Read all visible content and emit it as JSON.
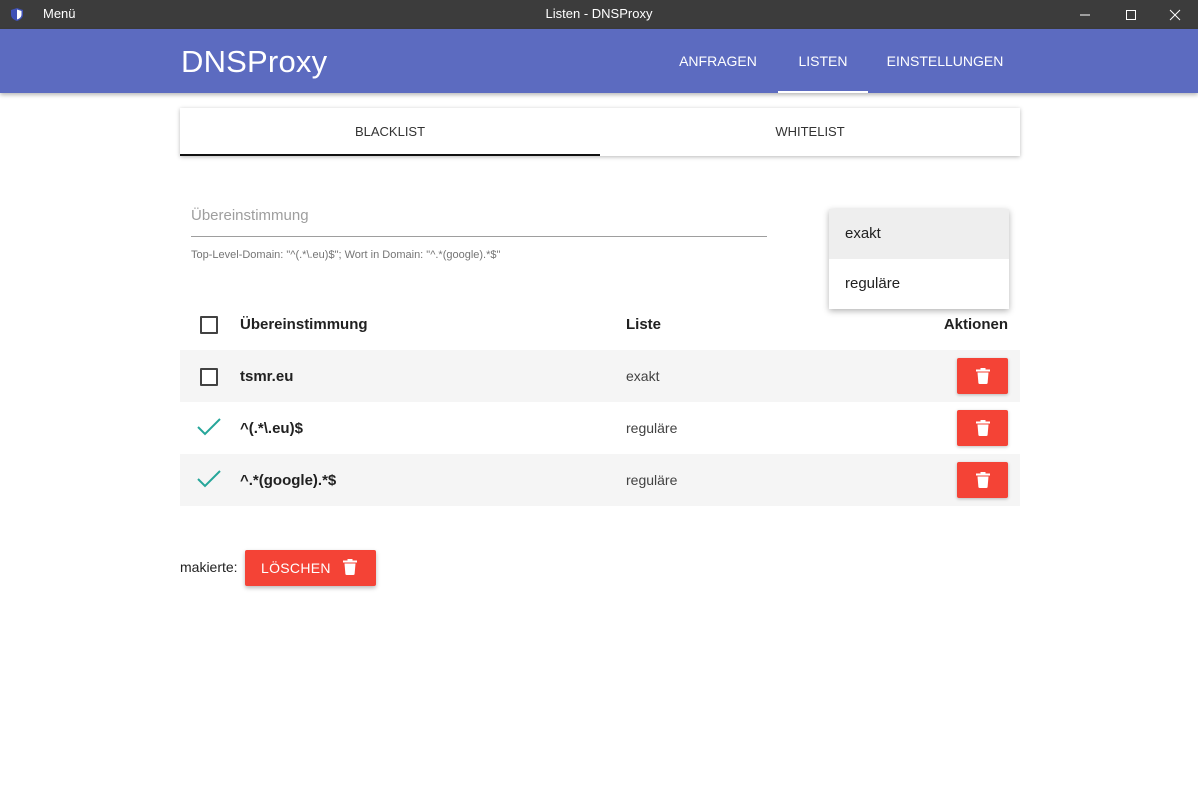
{
  "window": {
    "menu_label": "Menü",
    "title": "Listen - DNSProxy"
  },
  "appbar": {
    "brand": "DNSProxy",
    "nav": [
      "ANFRAGEN",
      "LISTEN",
      "EINSTELLUNGEN"
    ],
    "active_nav": "LISTEN"
  },
  "subtabs": {
    "items": [
      "BLACKLIST",
      "WHITELIST"
    ],
    "active": "BLACKLIST"
  },
  "form": {
    "placeholder": "Übereinstimmung",
    "value": "",
    "hint": "Top-Level-Domain: \"^(.*\\.eu)$\"; Wort in Domain: \"^.*(google).*$\"",
    "dropdown_options": [
      "exakt",
      "reguläre"
    ],
    "dropdown_highlighted": "exakt"
  },
  "table": {
    "headers": {
      "match": "Übereinstimmung",
      "list": "Liste",
      "actions": "Aktionen"
    },
    "rows": [
      {
        "match": "tsmr.eu",
        "list": "exakt",
        "checked": false
      },
      {
        "match": "^(.*\\.eu)$",
        "list": "reguläre",
        "checked": true
      },
      {
        "match": "^.*(google).*$",
        "list": "reguläre",
        "checked": true
      }
    ]
  },
  "bulk": {
    "label": "makierte:",
    "button_label": "LÖSCHEN"
  },
  "colors": {
    "titlebar": "#3c3c3c",
    "appbar": "#5c6bc0",
    "danger": "#f44336",
    "check": "#26a69a",
    "row_alt": "#f5f5f5"
  },
  "icons": {
    "app": "shield-icon",
    "delete": "trash-icon",
    "check": "check-icon"
  }
}
